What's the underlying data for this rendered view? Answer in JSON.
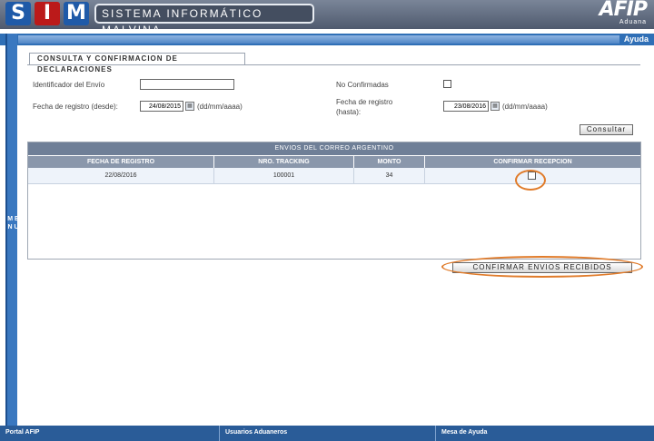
{
  "header": {
    "logo_letters": [
      "S",
      "I",
      "M"
    ],
    "system_title": "SISTEMA INFORMÁTICO MALVINA",
    "afip_mark": "AFIP",
    "afip_sub": "Aduana"
  },
  "topbar": {
    "help_label": "Ayuda"
  },
  "sidebar": {
    "menu_label": "M E N U"
  },
  "form": {
    "section_title": "CONSULTA Y CONFIRMACION DE DECLARACIONES",
    "envio_id_label": "Identificador del Envío",
    "envio_id_value": "",
    "no_confirmadas_label": "No Confirmadas",
    "no_confirmadas_checked": false,
    "date_from_label": "Fecha de registro (desde):",
    "date_from_value": "24/08/2015",
    "date_from_hint": "(dd/mm/aaaa)",
    "date_to_label_line1": "Fecha de registro",
    "date_to_label_line2": "(hasta):",
    "date_to_value": "23/08/2016",
    "date_to_hint": "(dd/mm/aaaa)",
    "calendar_glyph": "▦",
    "consultar_label": "Consultar"
  },
  "table": {
    "title": "ENVIOS DEL CORREO ARGENTINO",
    "columns": [
      "FECHA DE REGISTRO",
      "NRO. TRACKING",
      "MONTO",
      "CONFIRMAR RECEPCION"
    ],
    "rows": [
      {
        "fecha": "22/08/2016",
        "tracking": "100001",
        "monto": "34",
        "confirmar": false
      }
    ]
  },
  "actions": {
    "confirm_all_label": "CONFIRMAR ENVIOS RECIBIDOS"
  },
  "footer": {
    "portal": "Portal AFIP",
    "usuarios": "Usuarios Aduaneros",
    "mesa": "Mesa de Ayuda"
  },
  "colors": {
    "highlight": "#e07b2a",
    "header_blue": "#2f6fb6",
    "logo_red": "#bb1a1a"
  }
}
